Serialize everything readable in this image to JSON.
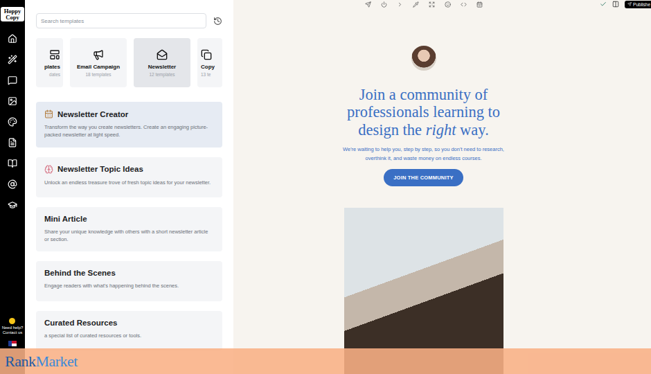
{
  "sidebar": {
    "logo": [
      "Hoppy",
      "Copy"
    ],
    "help": [
      "Need help?",
      "Contact us"
    ]
  },
  "search": {
    "placeholder": "Search templates"
  },
  "categories": [
    {
      "title": "plates",
      "count": "dates",
      "selected": false,
      "kind": "cut-left"
    },
    {
      "title": "Email Campaign",
      "count": "18 templates",
      "selected": false,
      "kind": "full"
    },
    {
      "title": "Newsletter",
      "count": "12 templates",
      "selected": true,
      "kind": "full"
    },
    {
      "title": "Copy",
      "count": "13 te",
      "selected": false,
      "kind": "cut-right"
    }
  ],
  "templates": [
    {
      "title": "Newsletter Creator",
      "description": "Transform the way you create newsletters. Create an engaging picture-packed newsletter at light speed.",
      "kind": "calendar",
      "selected": true
    },
    {
      "title": "Newsletter Topic Ideas",
      "description": "Unlock an endless treasure trove of fresh topic ideas for your newsletter.",
      "kind": "brain",
      "selected": false
    },
    {
      "title": "Mini Article",
      "description": "Share your unique knowledge with others with a short newsletter article or section.",
      "kind": "plain",
      "selected": false
    },
    {
      "title": "Behind the Scenes",
      "description": "Engage readers with what's happening behind the scenes.",
      "kind": "plain",
      "selected": false
    },
    {
      "title": "Curated Resources",
      "description": "a special list of curated resources or tools.",
      "kind": "plain",
      "selected": false
    }
  ],
  "toolbar": {
    "publish": "Publishe"
  },
  "preview": {
    "heading": [
      {
        "text": "Join a community of professionals learning to design the ",
        "italic": false
      },
      {
        "text": "right",
        "italic": true
      },
      {
        "text": " way.",
        "italic": false
      }
    ],
    "subtitle": "We're waiting to help you, step by step, so you don't need to research, overthink it, and waste money on endless courses.",
    "button": "JOIN THE COMMUNITY"
  },
  "watermark": {
    "brand": [
      "Rank",
      "Market"
    ]
  }
}
